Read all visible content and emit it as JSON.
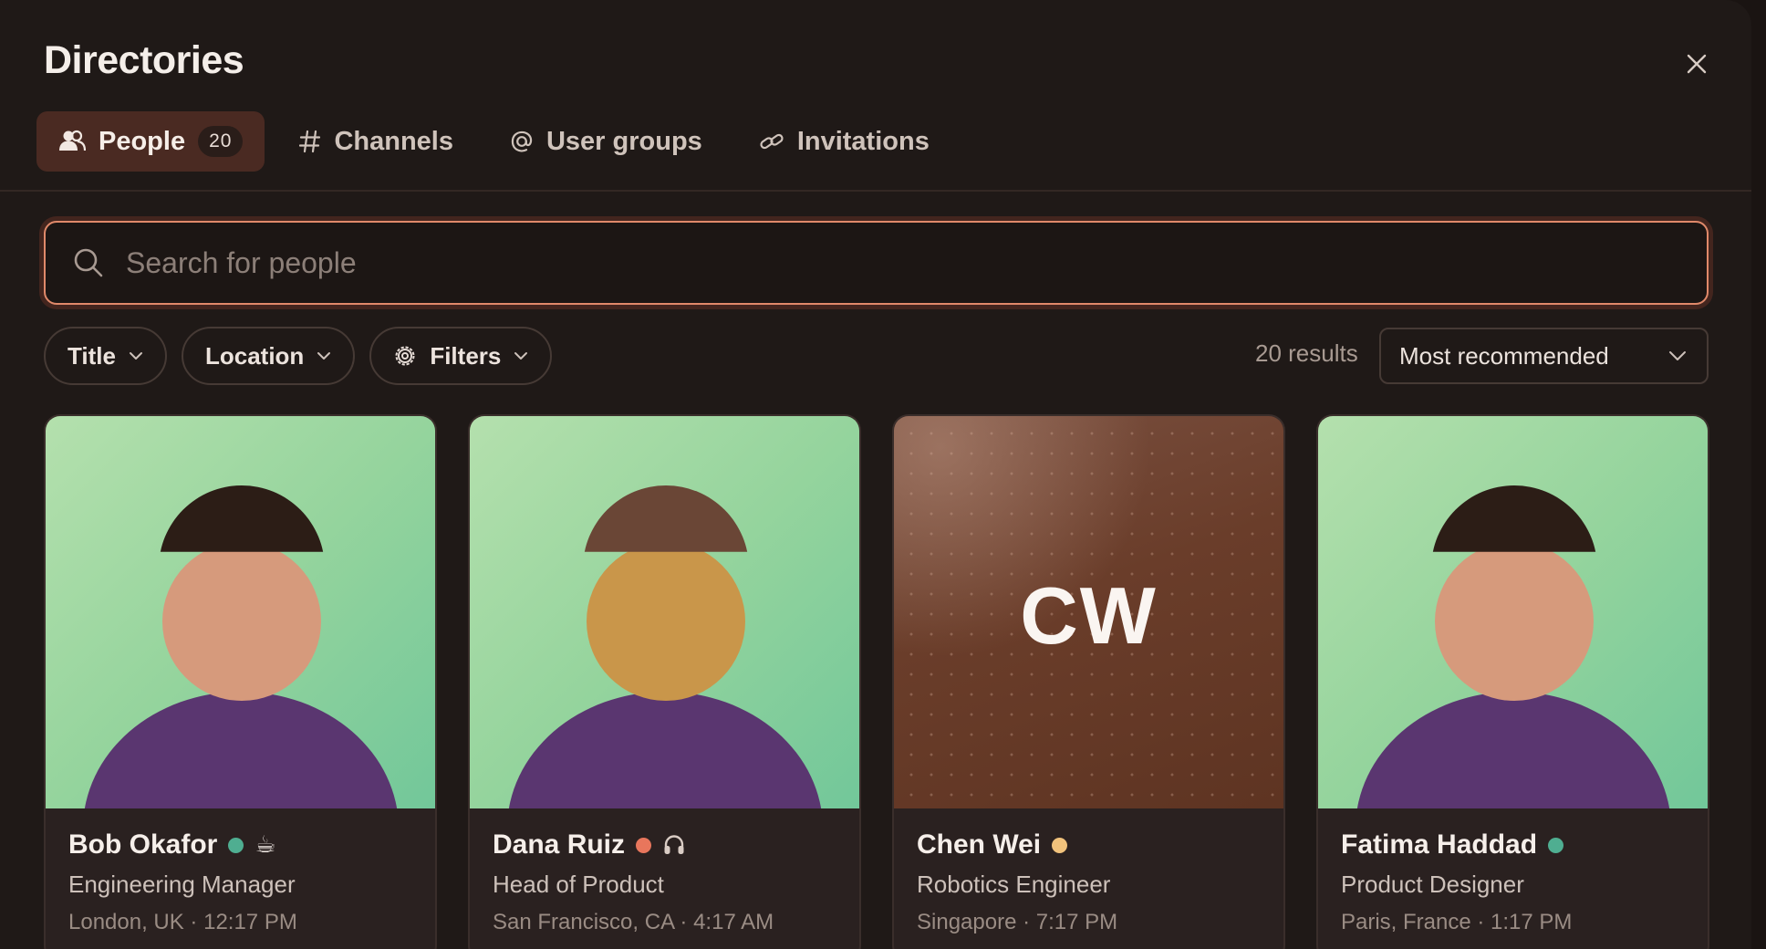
{
  "header": {
    "title": "Directories"
  },
  "tabs": [
    {
      "label": "People",
      "count": "20",
      "icon": "people-icon"
    },
    {
      "label": "Channels",
      "icon": "hash-icon"
    },
    {
      "label": "User groups",
      "icon": "at-icon"
    },
    {
      "label": "Invitations",
      "icon": "link-icon"
    }
  ],
  "search": {
    "placeholder": "Search for people",
    "value": ""
  },
  "filters": [
    {
      "label": "Title"
    },
    {
      "label": "Location"
    },
    {
      "label": "Filters",
      "icon": "gear-icon"
    }
  ],
  "results": {
    "text": "20 results"
  },
  "sort": {
    "selected": "Most recommended"
  },
  "colors": {
    "accent": "#e0896a",
    "status_online": "#4fae91",
    "status_busy": "#e8765c",
    "status_away": "#f1c27c",
    "avatar_bg": "#95d49d",
    "avatar_body": "#5a3670"
  },
  "people": [
    {
      "name": "Bob Okafor",
      "title": "Engineering Manager",
      "location": "London, UK · 12:17 PM",
      "status_color": "#4fae91",
      "status_emoji": "☕",
      "avatar": "illustration",
      "skin": "#d69a7c",
      "hair": "#2c1d16"
    },
    {
      "name": "Dana Ruiz",
      "title": "Head of Product",
      "location": "San Francisco, CA · 4:17 AM",
      "status_color": "#e8765c",
      "status_emoji": "🎧",
      "avatar": "illustration",
      "skin": "#c9964a",
      "hair": "#6a4636"
    },
    {
      "name": "Chen Wei",
      "title": "Robotics Engineer",
      "location": "Singapore · 7:17 PM",
      "status_color": "#f1c27c",
      "status_emoji": "",
      "avatar": "initials",
      "initials": "CW"
    },
    {
      "name": "Fatima Haddad",
      "title": "Product Designer",
      "location": "Paris, France · 1:17 PM",
      "status_color": "#4fae91",
      "status_emoji": "",
      "avatar": "illustration",
      "skin": "#d69a7c",
      "hair": "#2c1d16"
    }
  ]
}
